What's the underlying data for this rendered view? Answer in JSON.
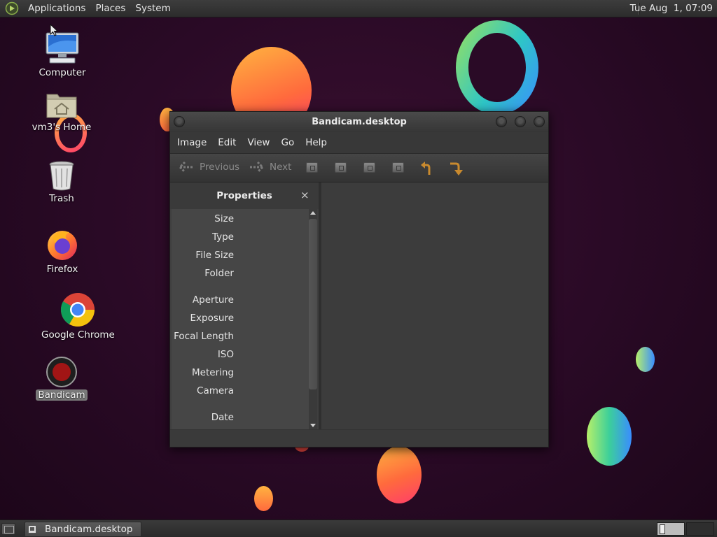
{
  "top_panel": {
    "menus": [
      "Applications",
      "Places",
      "System"
    ],
    "clock": "Tue Aug  1, 07:09"
  },
  "desktop": {
    "icons": [
      {
        "label": "Computer",
        "icon": "computer-icon"
      },
      {
        "label": "vm3's Home",
        "icon": "home-folder-icon"
      },
      {
        "label": "Trash",
        "icon": "trash-icon"
      },
      {
        "label": "Firefox",
        "icon": "firefox-icon"
      },
      {
        "label": "Google Chrome",
        "icon": "chrome-icon"
      },
      {
        "label": "Bandicam",
        "icon": "bandicam-icon",
        "selected": true
      }
    ]
  },
  "window": {
    "title": "Bandicam.desktop",
    "menus": [
      "Image",
      "Edit",
      "View",
      "Go",
      "Help"
    ],
    "toolbar": {
      "previous": "Previous",
      "next": "Next",
      "buttons": [
        "zoom-in-icon",
        "zoom-out-icon",
        "zoom-normal-icon",
        "zoom-fit-icon",
        "rotate-left-icon",
        "rotate-right-icon"
      ]
    },
    "sidepane": {
      "title": "Properties",
      "close": "×",
      "properties": [
        "Size",
        "Type",
        "File Size",
        "Folder",
        "Aperture",
        "Exposure",
        "Focal Length",
        "ISO",
        "Metering",
        "Camera",
        "Date"
      ]
    }
  },
  "bottom_panel": {
    "task": "Bandicam.desktop",
    "workspaces": 2
  },
  "colors": {
    "wallpaper": "#2a0a26",
    "panel": "#333333",
    "window_bg": "#3c3c3c",
    "accent_orange": "#c98a2e"
  }
}
